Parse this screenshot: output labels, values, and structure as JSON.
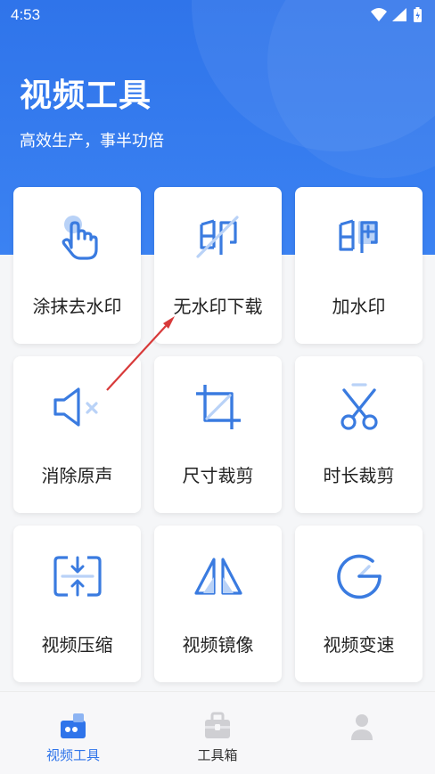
{
  "status_bar": {
    "time": "4:53"
  },
  "header": {
    "title": "视频工具",
    "subtitle": "高效生产，事半功倍"
  },
  "tools": [
    {
      "label": "涂抹去水印",
      "icon": "hand-touch-icon"
    },
    {
      "label": "无水印下载",
      "icon": "no-watermark-icon"
    },
    {
      "label": "加水印",
      "icon": "add-watermark-icon"
    },
    {
      "label": "消除原声",
      "icon": "mute-icon"
    },
    {
      "label": "尺寸裁剪",
      "icon": "crop-icon"
    },
    {
      "label": "时长裁剪",
      "icon": "scissors-icon"
    },
    {
      "label": "视频压缩",
      "icon": "compress-icon"
    },
    {
      "label": "视频镜像",
      "icon": "mirror-icon"
    },
    {
      "label": "视频变速",
      "icon": "speed-icon"
    }
  ],
  "bottom_nav": {
    "items": [
      {
        "label": "视频工具",
        "active": true
      },
      {
        "label": "工具箱",
        "active": false
      },
      {
        "label": "",
        "active": false
      }
    ]
  },
  "colors": {
    "accent": "#2f74ea",
    "icon": "#3a7be0",
    "inactive": "#c8c8c8",
    "annotation_arrow": "#d83a3a"
  }
}
